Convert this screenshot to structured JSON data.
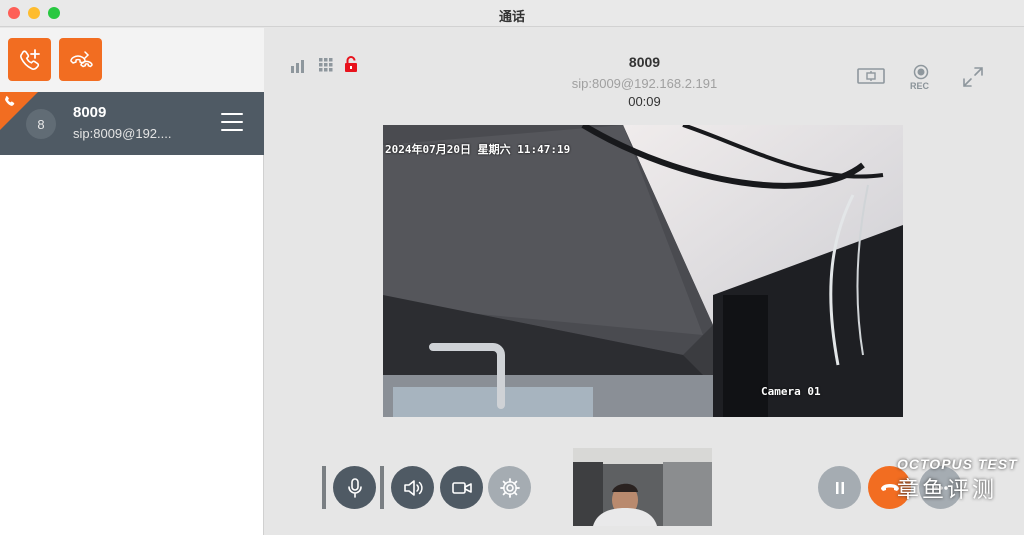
{
  "window": {
    "title": "通话"
  },
  "sidebar": {
    "call_item": {
      "avatar_initial": "8",
      "name": "8009",
      "sip": "sip:8009@192...."
    }
  },
  "call": {
    "name": "8009",
    "sip": "sip:8009@192.168.2.191",
    "duration": "00:09",
    "rec_label": "REC"
  },
  "video": {
    "timestamp": "2024年07月20日 星期六 11:47:19",
    "camera_label": "Camera 01"
  },
  "watermark": {
    "en": "OCTOPUS TEST",
    "cn": "章鱼评测"
  },
  "colors": {
    "accent": "#f26d21",
    "dark": "#4f5a64",
    "muted": "#a5acb2"
  }
}
